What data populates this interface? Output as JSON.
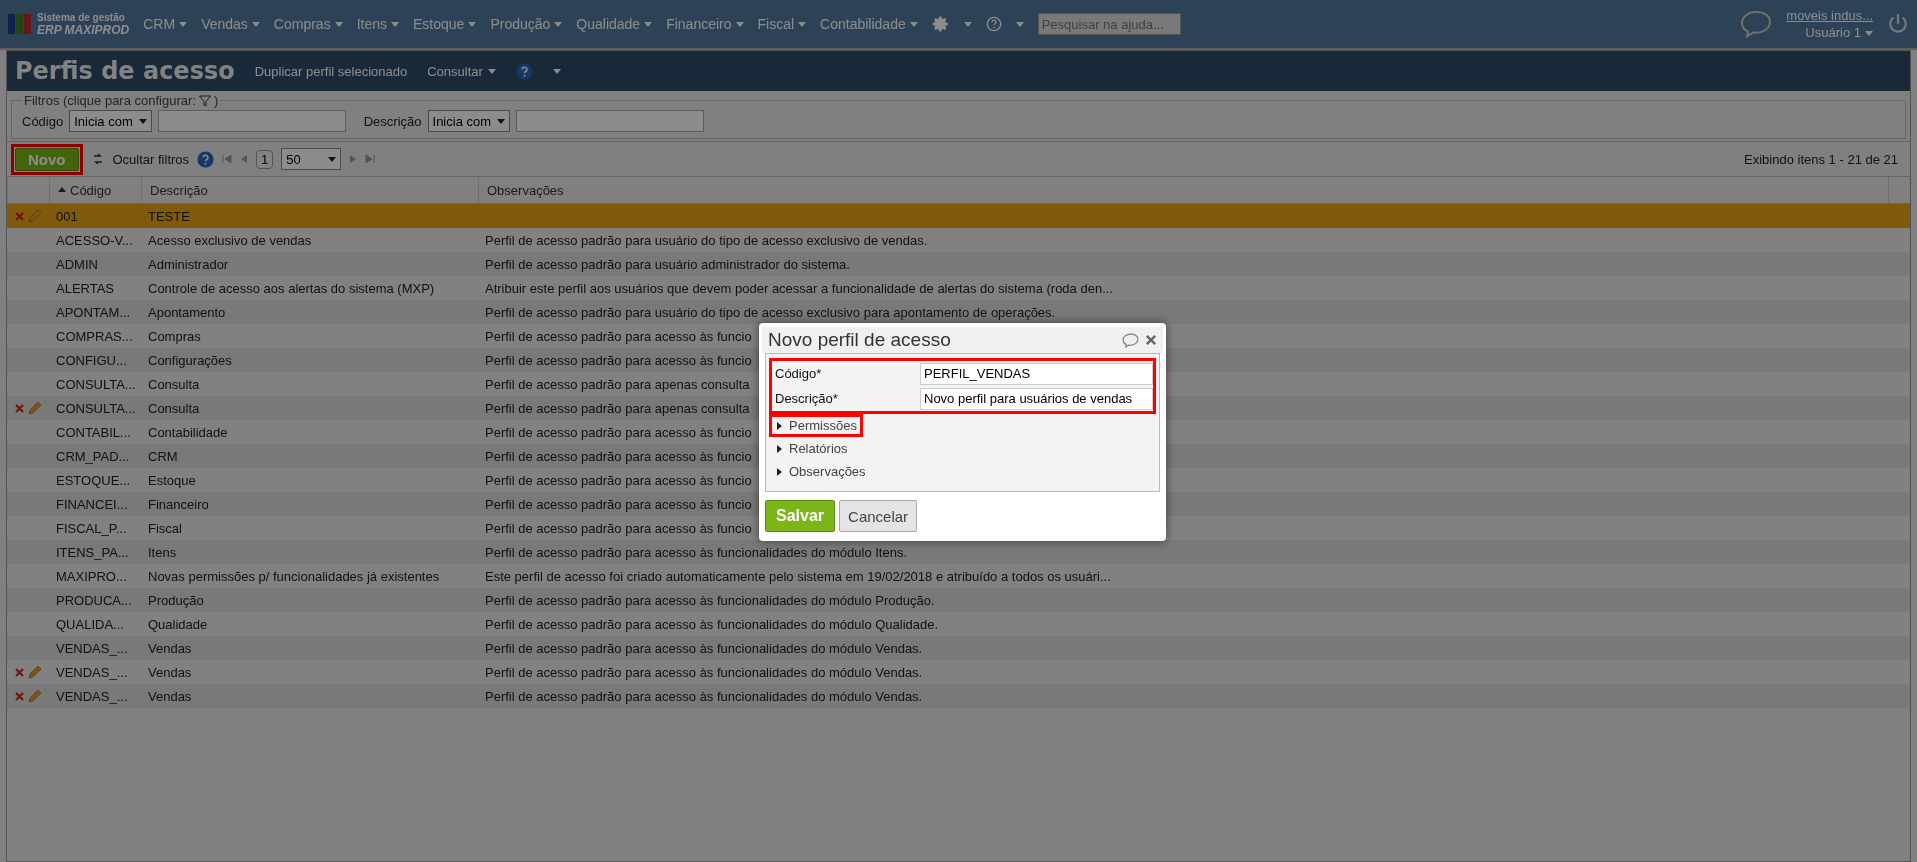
{
  "app": {
    "logo_line1": "Sistema de gestão",
    "logo_line2": "ERP MAXIPROD",
    "search_placeholder": "Pesquisar na ajuda...",
    "company": "moveis indus...",
    "user": "Usuário 1"
  },
  "menu": [
    "CRM",
    "Vendas",
    "Compras",
    "Itens",
    "Estoque",
    "Produção",
    "Qualidade",
    "Financeiro",
    "Fiscal",
    "Contabilidade"
  ],
  "page": {
    "title": "Perfis de acesso",
    "actions": [
      "Duplicar perfil selecionado",
      "Consultar"
    ]
  },
  "filters": {
    "legend": "Filtros (clique para configurar:",
    "legend_end": ")",
    "fields": [
      {
        "label": "Código",
        "operator": "Inicia com"
      },
      {
        "label": "Descrição",
        "operator": "Inicia com"
      }
    ]
  },
  "toolbar": {
    "new_button": {
      "label": "Novo",
      "highlighted": true
    },
    "hide_filters": "Ocultar filtros",
    "page": "1",
    "page_size": "50",
    "summary": "Exibindo itens 1 - 21 de 21"
  },
  "table": {
    "columns": [
      "Código",
      "Descrição",
      "Observações"
    ],
    "rows": [
      {
        "code": "001",
        "description": "TESTE",
        "notes": "",
        "selected": true,
        "actions": true
      },
      {
        "code": "ACESSO-V...",
        "description": "Acesso exclusivo de vendas",
        "notes": "Perfil de acesso padrão para usuário do tipo de acesso exclusivo de vendas.",
        "selected": false,
        "actions": false
      },
      {
        "code": "ADMIN",
        "description": "Administrador",
        "notes": "Perfil de acesso padrão para usuário administrador do sistema.",
        "selected": false,
        "actions": false
      },
      {
        "code": "ALERTAS",
        "description": "Controle de acesso aos alertas do sistema (MXP)",
        "notes": "Atribuir este perfil aos usuários que devem poder acessar a funcionalidade de alertas do sistema (roda den...",
        "selected": false,
        "actions": false
      },
      {
        "code": "APONTAM...",
        "description": "Apontamento",
        "notes": "Perfil de acesso padrão para usuário do tipo de acesso exclusivo para apontamento de operações.",
        "selected": false,
        "actions": false
      },
      {
        "code": "COMPRAS...",
        "description": "Compras",
        "notes": "Perfil de acesso padrão para acesso às funcio",
        "selected": false,
        "actions": false
      },
      {
        "code": "CONFIGU...",
        "description": "Configurações",
        "notes": "Perfil de acesso padrão para acesso às funcio",
        "selected": false,
        "actions": false
      },
      {
        "code": "CONSULTA...",
        "description": "Consulta",
        "notes": "Perfil de acesso padrão para apenas consulta",
        "selected": false,
        "actions": false
      },
      {
        "code": "CONSULTA...",
        "description": "Consulta",
        "notes": "Perfil de acesso padrão para apenas consulta",
        "selected": false,
        "actions": true
      },
      {
        "code": "CONTABIL...",
        "description": "Contabilidade",
        "notes": "Perfil de acesso padrão para acesso às funcio",
        "selected": false,
        "actions": false
      },
      {
        "code": "CRM_PAD...",
        "description": "CRM",
        "notes": "Perfil de acesso padrão para acesso às funcio",
        "selected": false,
        "actions": false
      },
      {
        "code": "ESTOQUE...",
        "description": "Estoque",
        "notes": "Perfil de acesso padrão para acesso às funcio",
        "selected": false,
        "actions": false
      },
      {
        "code": "FINANCEI...",
        "description": "Financeiro",
        "notes": "Perfil de acesso padrão para acesso às funcio",
        "selected": false,
        "actions": false
      },
      {
        "code": "FISCAL_P...",
        "description": "Fiscal",
        "notes": "Perfil de acesso padrão para acesso às funcio",
        "selected": false,
        "actions": false
      },
      {
        "code": "ITENS_PA...",
        "description": "Itens",
        "notes": "Perfil de acesso padrão para acesso às funcionalidades do módulo Itens.",
        "selected": false,
        "actions": false
      },
      {
        "code": "MAXIPRO...",
        "description": "Novas permissões p/ funcionalidades já existentes",
        "notes": "Este perfil de acesso foi criado automaticamente pelo sistema em 19/02/2018 e atribuído a todos os usuári...",
        "selected": false,
        "actions": false
      },
      {
        "code": "PRODUCA...",
        "description": "Produção",
        "notes": "Perfil de acesso padrão para acesso às funcionalidades do módulo Produção.",
        "selected": false,
        "actions": false
      },
      {
        "code": "QUALIDA...",
        "description": "Qualidade",
        "notes": "Perfil de acesso padrão para acesso às funcionalidades do módulo Qualidade.",
        "selected": false,
        "actions": false
      },
      {
        "code": "VENDAS_...",
        "description": "Vendas",
        "notes": "Perfil de acesso padrão para acesso às funcionalidades do módulo Vendas.",
        "selected": false,
        "actions": false
      },
      {
        "code": "VENDAS_...",
        "description": "Vendas",
        "notes": "Perfil de acesso padrão para acesso às funcionalidades do módulo Vendas.",
        "selected": false,
        "actions": true
      },
      {
        "code": "VENDAS_...",
        "description": "Vendas",
        "notes": "Perfil de acesso padrão para acesso às funcionalidades do módulo Vendas.",
        "selected": false,
        "actions": true
      }
    ]
  },
  "dialog": {
    "title": "Novo perfil de acesso",
    "fields_highlighted": true,
    "fields": [
      {
        "label": "Código*",
        "value": "PERFIL_VENDAS"
      },
      {
        "label": "Descrição*",
        "value": "Novo perfil para usuários de vendas"
      }
    ],
    "sections": [
      {
        "label": "Permissões",
        "expanded": false,
        "highlighted": true
      },
      {
        "label": "Relatórios",
        "expanded": false,
        "highlighted": false
      },
      {
        "label": "Observações",
        "expanded": false,
        "highlighted": false
      }
    ],
    "buttons": [
      "Salvar",
      "Cancelar"
    ]
  }
}
